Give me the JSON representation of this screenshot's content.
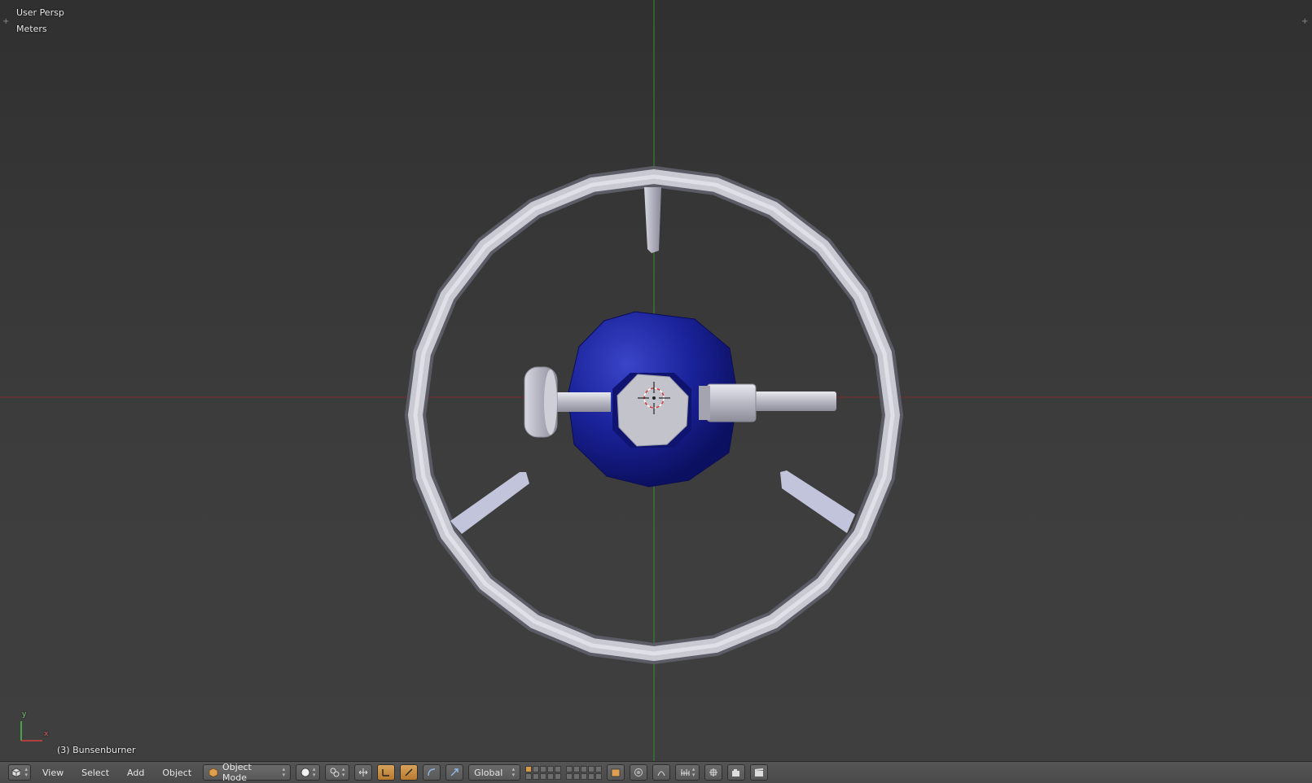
{
  "viewport": {
    "view_name": "User Persp",
    "units": "Meters",
    "object_info": "(3) Bunsenburner",
    "axis_labels": {
      "y": "y",
      "x": "x"
    },
    "colors": {
      "x_axis": "#8b2a2a",
      "y_axis": "#2f8f2f",
      "object_blue": "#141a8a",
      "metal": "#c8c8d0"
    }
  },
  "toolbar": {
    "editor_type_icon": "3d-view-icon",
    "menus": [
      "View",
      "Select",
      "Add",
      "Object"
    ],
    "mode": "Object Mode",
    "mode_icon": "object-mode-cube-icon",
    "shading_icon": "solid-shading-sphere-icon",
    "orientation": "Global",
    "accent": "#d39a48"
  }
}
